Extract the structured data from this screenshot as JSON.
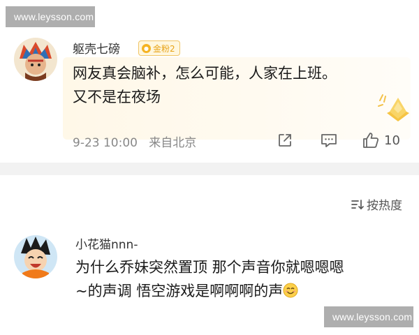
{
  "watermarks": {
    "top": "www.leysson.com",
    "bottom": "www.leysson.com"
  },
  "comments": [
    {
      "username": "躯壳七磅",
      "badge": "金粉2",
      "text_line1": "网友真会脑补，怎么可能，人家在上班。",
      "text_line2": "又不是在夜场",
      "time": "9-23 10:00",
      "location": "来自北京",
      "likes": "10"
    },
    {
      "username": "小花猫nnn-",
      "text_line1": "为什么乔妹突然置顶 那个声音你就嗯嗯嗯",
      "text_line2": "~的声调  悟空游戏是啊啊啊的声"
    }
  ],
  "sort": {
    "label": "按热度"
  },
  "colors": {
    "badge_gold": "#f5b323",
    "meta_gray": "#888888",
    "divider": "#f2f2f2"
  },
  "icons": [
    "share-icon",
    "comment-icon",
    "thumbs-up-icon",
    "sort-icon",
    "smile-emoji-icon",
    "gold-medal-icon"
  ]
}
